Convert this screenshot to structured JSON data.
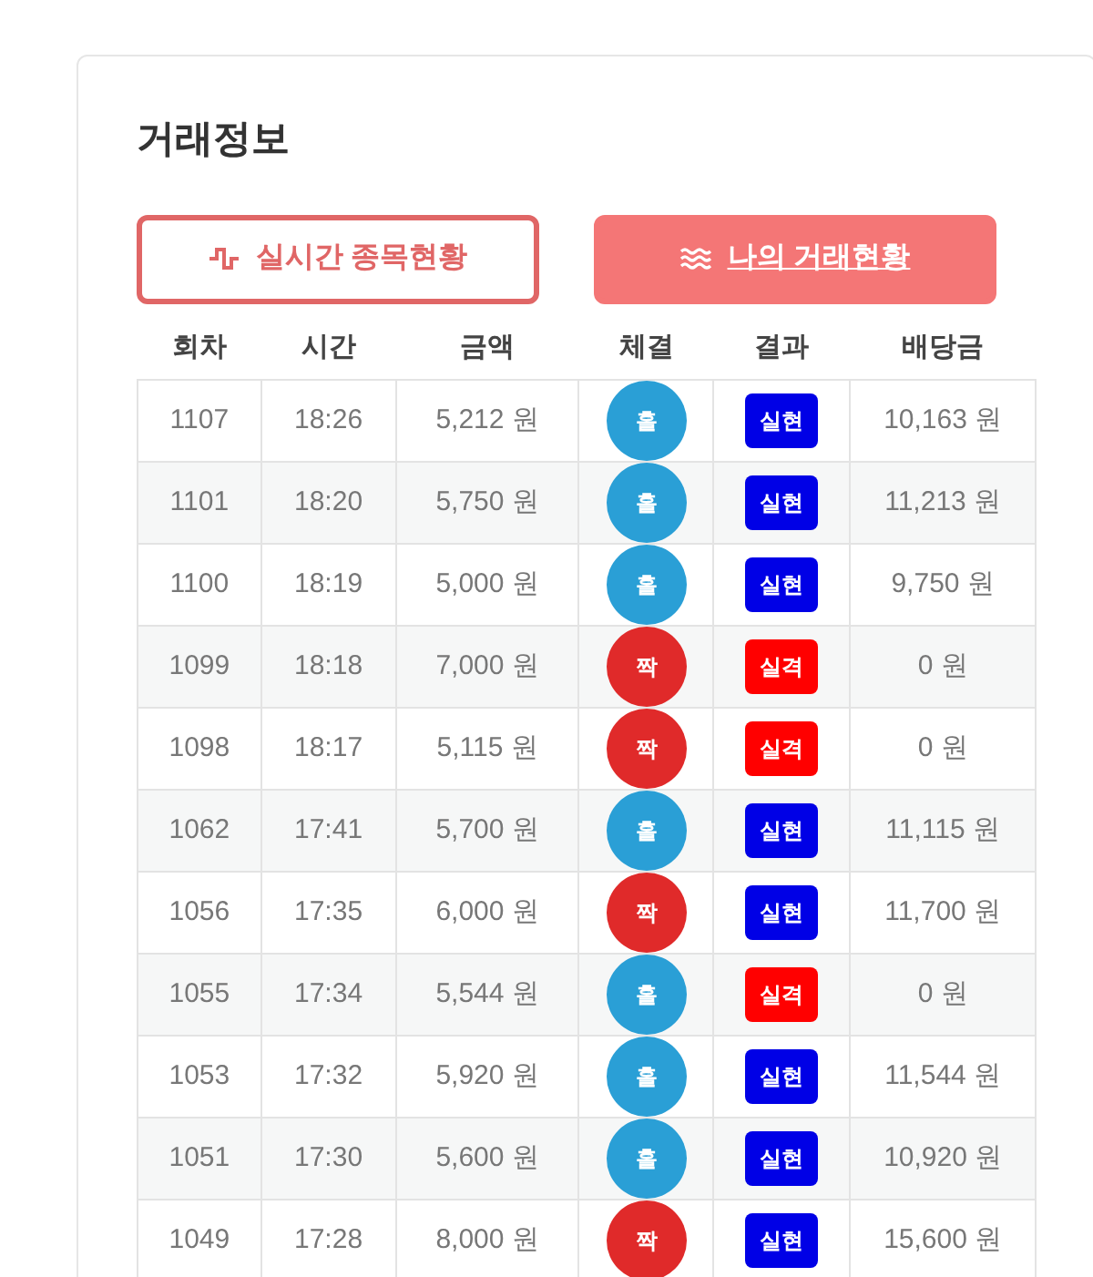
{
  "title": "거래정보",
  "tabs": [
    {
      "label": "실시간 종목현황",
      "kind": "pulse",
      "selected": false
    },
    {
      "label": "나의 거래현황",
      "kind": "waves",
      "selected": true
    }
  ],
  "table": {
    "columns": [
      "회차",
      "시간",
      "금액",
      "체결",
      "결과",
      "배당금"
    ],
    "rows": [
      {
        "round": "1107",
        "time": "18:26",
        "amount": "5,212 원",
        "fill": {
          "kind": "odd",
          "label": "홀"
        },
        "result": {
          "kind": "win",
          "label": "실현"
        },
        "payout": "10,163 원"
      },
      {
        "round": "1101",
        "time": "18:20",
        "amount": "5,750 원",
        "fill": {
          "kind": "odd",
          "label": "홀"
        },
        "result": {
          "kind": "win",
          "label": "실현"
        },
        "payout": "11,213 원"
      },
      {
        "round": "1100",
        "time": "18:19",
        "amount": "5,000 원",
        "fill": {
          "kind": "odd",
          "label": "홀"
        },
        "result": {
          "kind": "win",
          "label": "실현"
        },
        "payout": "9,750 원"
      },
      {
        "round": "1099",
        "time": "18:18",
        "amount": "7,000 원",
        "fill": {
          "kind": "even",
          "label": "짝"
        },
        "result": {
          "kind": "loss",
          "label": "실격"
        },
        "payout": "0 원"
      },
      {
        "round": "1098",
        "time": "18:17",
        "amount": "5,115 원",
        "fill": {
          "kind": "even",
          "label": "짝"
        },
        "result": {
          "kind": "loss",
          "label": "실격"
        },
        "payout": "0 원"
      },
      {
        "round": "1062",
        "time": "17:41",
        "amount": "5,700 원",
        "fill": {
          "kind": "odd",
          "label": "홀"
        },
        "result": {
          "kind": "win",
          "label": "실현"
        },
        "payout": "11,115 원"
      },
      {
        "round": "1056",
        "time": "17:35",
        "amount": "6,000 원",
        "fill": {
          "kind": "even",
          "label": "짝"
        },
        "result": {
          "kind": "win",
          "label": "실현"
        },
        "payout": "11,700 원"
      },
      {
        "round": "1055",
        "time": "17:34",
        "amount": "5,544 원",
        "fill": {
          "kind": "odd",
          "label": "홀"
        },
        "result": {
          "kind": "loss",
          "label": "실격"
        },
        "payout": "0 원"
      },
      {
        "round": "1053",
        "time": "17:32",
        "amount": "5,920 원",
        "fill": {
          "kind": "odd",
          "label": "홀"
        },
        "result": {
          "kind": "win",
          "label": "실현"
        },
        "payout": "11,544 원"
      },
      {
        "round": "1051",
        "time": "17:30",
        "amount": "5,600 원",
        "fill": {
          "kind": "odd",
          "label": "홀"
        },
        "result": {
          "kind": "win",
          "label": "실현"
        },
        "payout": "10,920 원"
      },
      {
        "round": "1049",
        "time": "17:28",
        "amount": "8,000 원",
        "fill": {
          "kind": "even",
          "label": "짝"
        },
        "result": {
          "kind": "win",
          "label": "실현"
        },
        "payout": "15,600 원"
      }
    ]
  }
}
